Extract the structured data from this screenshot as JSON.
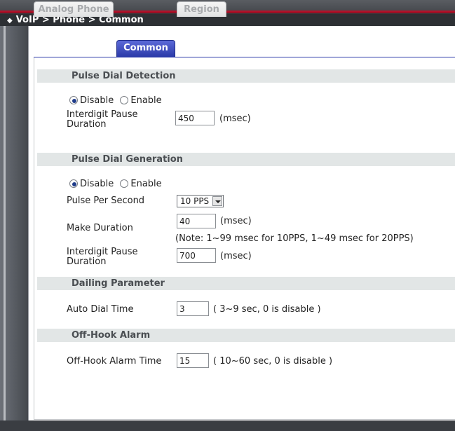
{
  "breadcrumb": "VoIP > Phone > Common",
  "tabs": [
    {
      "label": "Analog Phone",
      "active": false
    },
    {
      "label": "Common",
      "active": true
    },
    {
      "label": "Region",
      "active": false
    }
  ],
  "pulse_dial_detection": {
    "title": "Pulse Dial Detection",
    "disable_label": "Disable",
    "enable_label": "Enable",
    "selected": "Disable",
    "interdigit_label": "Interdigit Pause Duration",
    "interdigit_value": "450",
    "unit": "(msec)"
  },
  "pulse_dial_generation": {
    "title": "Pulse Dial Generation",
    "disable_label": "Disable",
    "enable_label": "Enable",
    "selected": "Disable",
    "pps_label": "Pulse Per Second",
    "pps_value": "10 PPS",
    "make_label": "Make Duration",
    "make_value": "40",
    "make_unit": "(msec)",
    "note": "(Note: 1~99 msec for 10PPS, 1~49 msec for 20PPS)",
    "interdigit_label": "Interdigit Pause Duration",
    "interdigit_value": "700",
    "interdigit_unit": "(msec)"
  },
  "dialing_parameter": {
    "title": "Dailing Parameter",
    "auto_dial_label": "Auto Dial Time",
    "auto_dial_value": "3",
    "auto_dial_hint": "( 3~9 sec, 0 is disable )"
  },
  "off_hook_alarm": {
    "title": "Off-Hook Alarm",
    "alarm_label": "Off-Hook Alarm Time",
    "alarm_value": "15",
    "alarm_hint": "( 10~60 sec, 0 is disable )"
  },
  "colors": {
    "accent": "#2b3aa9",
    "header_bg": "#e2e6e6",
    "top_stripe": "#b0122a"
  }
}
